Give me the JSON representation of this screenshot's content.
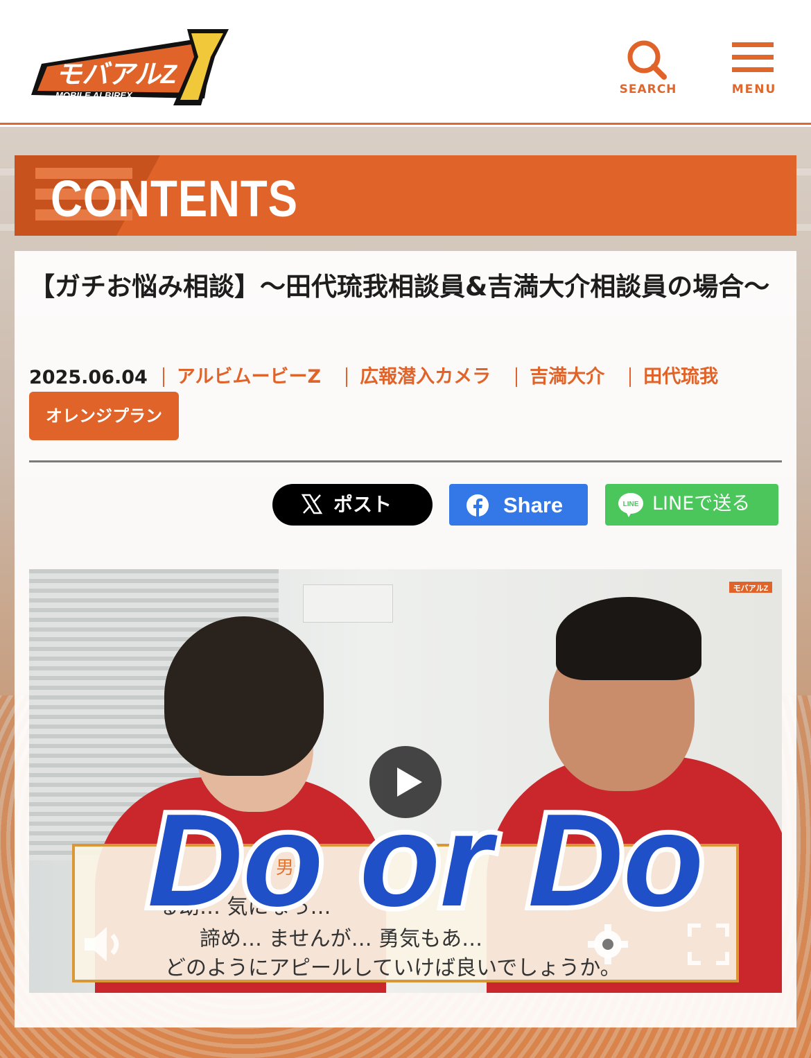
{
  "header": {
    "logo_text": "モバアルZ",
    "logo_sub": "MOBILE ALBIREX",
    "search_label": "SEARCH",
    "menu_label": "MENU"
  },
  "section": {
    "title": "CONTENTS"
  },
  "article": {
    "title": "【ガチお悩み相談】〜田代琉我相談員&吉満大介相談員の場合〜",
    "date": "2025.06.04",
    "tags": [
      "アルビムービーZ",
      "広報潜入カメラ",
      "吉満大介",
      "田代琉我"
    ],
    "plan_badge": "オレンジプラン"
  },
  "share": {
    "x_label": "ポスト",
    "fb_label": "Share",
    "line_label": "LINEで送る"
  },
  "video": {
    "overlay_title": "Do or Do",
    "subtitle_who": "男性",
    "subtitle_line1": "る幼… 気になっ…",
    "subtitle_line2": "諦め… ませんが… 勇気もあ…",
    "subtitle_line3": "どのようにアピールしていけば良いでしょうか。",
    "logo_text": "モバアルZ"
  },
  "colors": {
    "accent": "#e0642a",
    "x": "#000000",
    "facebook": "#3478e8",
    "line": "#4bc65b"
  },
  "icons": [
    "search-icon",
    "menu-icon",
    "x-logo-icon",
    "facebook-icon",
    "line-icon",
    "play-icon",
    "volume-icon",
    "settings-gear-icon",
    "fullscreen-icon"
  ]
}
